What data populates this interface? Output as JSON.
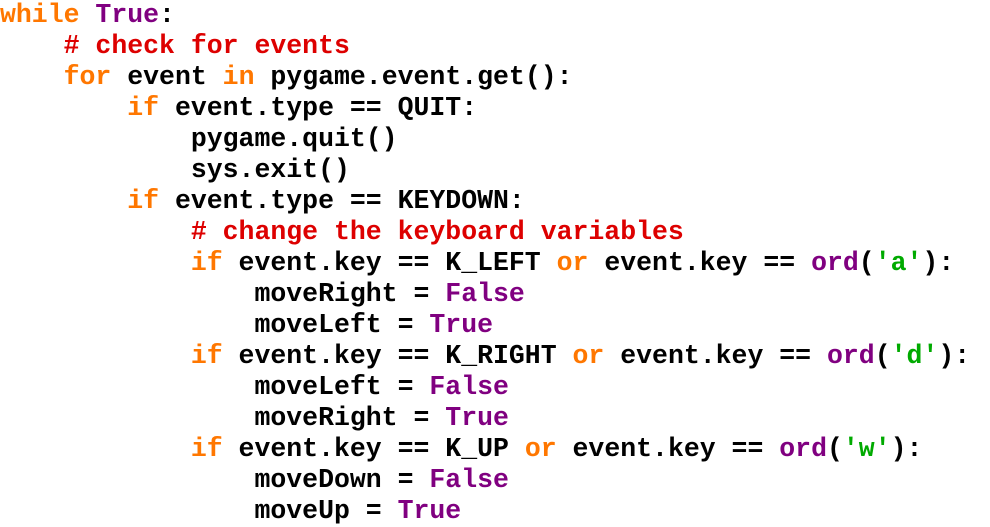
{
  "colors": {
    "keyword": "#ff7700",
    "constant": "#800080",
    "builtin": "#800080",
    "comment": "#dd0000",
    "string": "#00aa00",
    "plain": "#000000"
  },
  "code_lines": [
    {
      "indent": "",
      "tokens": [
        {
          "t": "keyword",
          "v": "while"
        },
        {
          "t": "plain",
          "v": " "
        },
        {
          "t": "const",
          "v": "True"
        },
        {
          "t": "plain",
          "v": ":"
        }
      ]
    },
    {
      "indent": "    ",
      "tokens": [
        {
          "t": "comment",
          "v": "# check for events"
        }
      ]
    },
    {
      "indent": "    ",
      "tokens": [
        {
          "t": "keyword",
          "v": "for"
        },
        {
          "t": "plain",
          "v": " event "
        },
        {
          "t": "keyword",
          "v": "in"
        },
        {
          "t": "plain",
          "v": " pygame.event.get():"
        }
      ]
    },
    {
      "indent": "        ",
      "tokens": [
        {
          "t": "keyword",
          "v": "if"
        },
        {
          "t": "plain",
          "v": " event.type == QUIT:"
        }
      ]
    },
    {
      "indent": "            ",
      "tokens": [
        {
          "t": "plain",
          "v": "pygame.quit()"
        }
      ]
    },
    {
      "indent": "            ",
      "tokens": [
        {
          "t": "plain",
          "v": "sys.exit()"
        }
      ]
    },
    {
      "indent": "        ",
      "tokens": [
        {
          "t": "keyword",
          "v": "if"
        },
        {
          "t": "plain",
          "v": " event.type == KEYDOWN:"
        }
      ]
    },
    {
      "indent": "            ",
      "tokens": [
        {
          "t": "comment",
          "v": "# change the keyboard variables"
        }
      ]
    },
    {
      "indent": "            ",
      "tokens": [
        {
          "t": "keyword",
          "v": "if"
        },
        {
          "t": "plain",
          "v": " event.key == K_LEFT "
        },
        {
          "t": "keyword",
          "v": "or"
        },
        {
          "t": "plain",
          "v": " event.key == "
        },
        {
          "t": "builtin",
          "v": "ord"
        },
        {
          "t": "plain",
          "v": "("
        },
        {
          "t": "string",
          "v": "'a'"
        },
        {
          "t": "plain",
          "v": "):"
        }
      ]
    },
    {
      "indent": "                ",
      "tokens": [
        {
          "t": "plain",
          "v": "moveRight = "
        },
        {
          "t": "const",
          "v": "False"
        }
      ]
    },
    {
      "indent": "                ",
      "tokens": [
        {
          "t": "plain",
          "v": "moveLeft = "
        },
        {
          "t": "const",
          "v": "True"
        }
      ]
    },
    {
      "indent": "            ",
      "tokens": [
        {
          "t": "keyword",
          "v": "if"
        },
        {
          "t": "plain",
          "v": " event.key == K_RIGHT "
        },
        {
          "t": "keyword",
          "v": "or"
        },
        {
          "t": "plain",
          "v": " event.key == "
        },
        {
          "t": "builtin",
          "v": "ord"
        },
        {
          "t": "plain",
          "v": "("
        },
        {
          "t": "string",
          "v": "'d'"
        },
        {
          "t": "plain",
          "v": "):"
        }
      ]
    },
    {
      "indent": "                ",
      "tokens": [
        {
          "t": "plain",
          "v": "moveLeft = "
        },
        {
          "t": "const",
          "v": "False"
        }
      ]
    },
    {
      "indent": "                ",
      "tokens": [
        {
          "t": "plain",
          "v": "moveRight = "
        },
        {
          "t": "const",
          "v": "True"
        }
      ]
    },
    {
      "indent": "            ",
      "tokens": [
        {
          "t": "keyword",
          "v": "if"
        },
        {
          "t": "plain",
          "v": " event.key == K_UP "
        },
        {
          "t": "keyword",
          "v": "or"
        },
        {
          "t": "plain",
          "v": " event.key == "
        },
        {
          "t": "builtin",
          "v": "ord"
        },
        {
          "t": "plain",
          "v": "("
        },
        {
          "t": "string",
          "v": "'w'"
        },
        {
          "t": "plain",
          "v": "):"
        }
      ]
    },
    {
      "indent": "                ",
      "tokens": [
        {
          "t": "plain",
          "v": "moveDown = "
        },
        {
          "t": "const",
          "v": "False"
        }
      ]
    },
    {
      "indent": "                ",
      "tokens": [
        {
          "t": "plain",
          "v": "moveUp = "
        },
        {
          "t": "const",
          "v": "True"
        }
      ]
    }
  ]
}
